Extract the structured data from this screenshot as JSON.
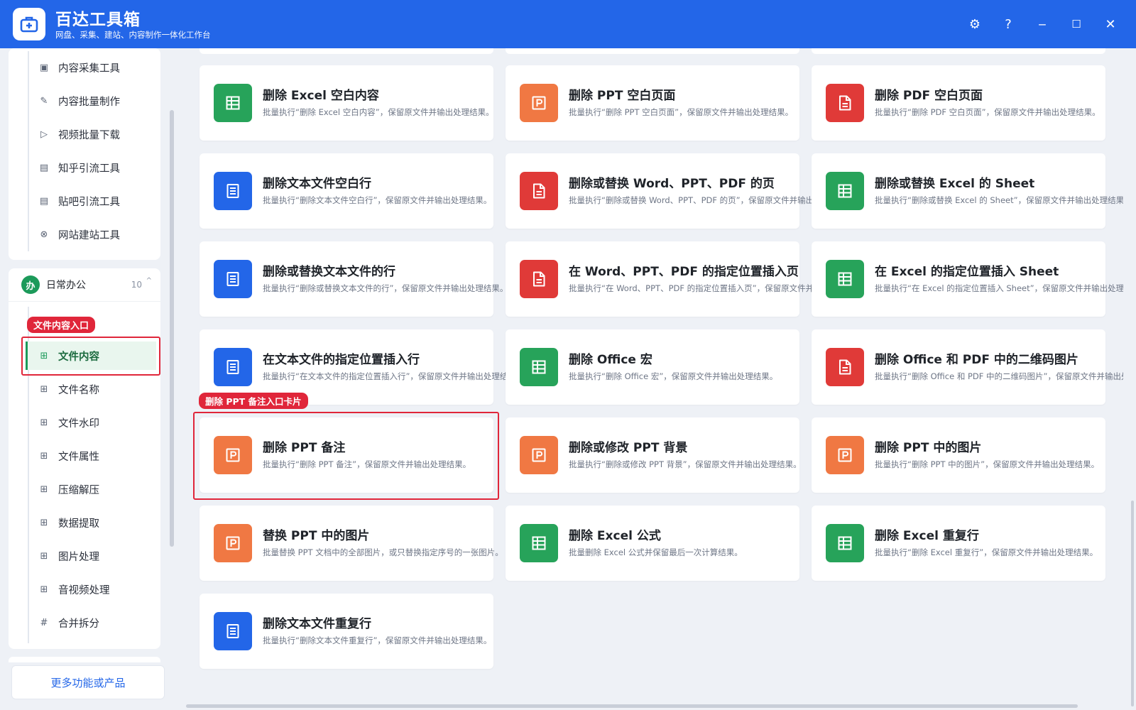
{
  "app": {
    "title": "百达工具箱",
    "subtitle": "网盘、采集、建站、内容制作一体化工作台",
    "controls": {
      "settings": "⚙",
      "help": "?",
      "minimize": "‒",
      "maximize": "☐",
      "close": "✕"
    }
  },
  "sidebar": {
    "upper_items": [
      {
        "label": "内容采集工具",
        "icon": "▣"
      },
      {
        "label": "内容批量制作",
        "icon": "✎"
      },
      {
        "label": "视频批量下载",
        "icon": "▷"
      },
      {
        "label": "知乎引流工具",
        "icon": "▤"
      },
      {
        "label": "贴吧引流工具",
        "icon": "▤"
      },
      {
        "label": "网站建站工具",
        "icon": "⊗"
      }
    ],
    "group": {
      "icon": "办",
      "label": "日常办公",
      "count": "10",
      "caret": "^"
    },
    "group_items": [
      {
        "label": "文件内容",
        "icon": "⊞"
      },
      {
        "label": "文件名称",
        "icon": "⊞"
      },
      {
        "label": "文件水印",
        "icon": "⊞"
      },
      {
        "label": "文件属性",
        "icon": "⊞"
      },
      {
        "label": "压缩解压",
        "icon": "⊞"
      },
      {
        "label": "数据提取",
        "icon": "⊞"
      },
      {
        "label": "图片处理",
        "icon": "⊞"
      },
      {
        "label": "音视频处理",
        "icon": "⊞"
      },
      {
        "label": "合并拆分",
        "icon": "#"
      }
    ],
    "more_button": "更多功能或产品"
  },
  "annotations": {
    "sidebar_tag": "文件内容入口",
    "card_tag": "删除 PPT 备注入口卡片"
  },
  "colors": {
    "green": "#27a35a",
    "orange": "#f07843",
    "red": "#e03a38",
    "blue": "#2366e8"
  },
  "cards": [
    {
      "title": "删除 Excel 空白内容",
      "desc": "批量执行“删除 Excel 空白内容”，保留原文件并输出处理结果。",
      "icon": "excel-sheet-icon",
      "color": "green"
    },
    {
      "title": "删除 PPT 空白页面",
      "desc": "批量执行“删除 PPT 空白页面”，保留原文件并输出处理结果。",
      "icon": "ppt-icon",
      "color": "orange"
    },
    {
      "title": "删除 PDF 空白页面",
      "desc": "批量执行“删除 PDF 空白页面”，保留原文件并输出处理结果。",
      "icon": "pdf-doc-icon",
      "color": "red"
    },
    {
      "title": "删除文本文件空白行",
      "desc": "批量执行“删除文本文件空白行”，保留原文件并输出处理结果。",
      "icon": "text-doc-icon",
      "color": "blue"
    },
    {
      "title": "删除或替换 Word、PPT、PDF 的页",
      "desc": "批量执行“删除或替换 Word、PPT、PDF 的页”，保留原文件并输出处理结果。",
      "icon": "pdf-doc-icon",
      "color": "red"
    },
    {
      "title": "删除或替换 Excel 的 Sheet",
      "desc": "批量执行“删除或替换 Excel 的 Sheet”，保留原文件并输出处理结果。",
      "icon": "excel-sheet-icon",
      "color": "green"
    },
    {
      "title": "删除或替换文本文件的行",
      "desc": "批量执行“删除或替换文本文件的行”，保留原文件并输出处理结果。",
      "icon": "text-doc-icon",
      "color": "blue"
    },
    {
      "title": "在 Word、PPT、PDF 的指定位置插入页",
      "desc": "批量执行“在 Word、PPT、PDF 的指定位置插入页”，保留原文件并输出处理结果。",
      "icon": "pdf-doc-icon",
      "color": "red"
    },
    {
      "title": "在 Excel 的指定位置插入 Sheet",
      "desc": "批量执行“在 Excel 的指定位置插入 Sheet”，保留原文件并输出处理结果。",
      "icon": "excel-sheet-icon",
      "color": "green"
    },
    {
      "title": "在文本文件的指定位置插入行",
      "desc": "批量执行“在文本文件的指定位置插入行”，保留原文件并输出处理结果。",
      "icon": "text-doc-icon",
      "color": "blue"
    },
    {
      "title": "删除 Office 宏",
      "desc": "批量执行“删除 Office 宏”，保留原文件并输出处理结果。",
      "icon": "excel-sheet-icon",
      "color": "green"
    },
    {
      "title": "删除 Office 和 PDF 中的二维码图片",
      "desc": "批量执行“删除 Office 和 PDF 中的二维码图片”，保留原文件并输出处理结果。",
      "icon": "pdf-doc-icon",
      "color": "red"
    },
    {
      "title": "删除 PPT 备注",
      "desc": "批量执行“删除 PPT 备注”，保留原文件并输出处理结果。",
      "icon": "ppt-icon",
      "color": "orange"
    },
    {
      "title": "删除或修改 PPT 背景",
      "desc": "批量执行“删除或修改 PPT 背景”，保留原文件并输出处理结果。",
      "icon": "ppt-icon",
      "color": "orange"
    },
    {
      "title": "删除 PPT 中的图片",
      "desc": "批量执行“删除 PPT 中的图片”，保留原文件并输出处理结果。",
      "icon": "ppt-icon",
      "color": "orange"
    },
    {
      "title": "替换 PPT 中的图片",
      "desc": "批量替换 PPT 文档中的全部图片，或只替换指定序号的一张图片。",
      "icon": "ppt-icon",
      "color": "orange"
    },
    {
      "title": "删除 Excel 公式",
      "desc": "批量删除 Excel 公式并保留最后一次计算结果。",
      "icon": "excel-sheet-icon",
      "color": "green"
    },
    {
      "title": "删除 Excel 重复行",
      "desc": "批量执行“删除 Excel 重复行”，保留原文件并输出处理结果。",
      "icon": "excel-sheet-icon",
      "color": "green"
    },
    {
      "title": "删除文本文件重复行",
      "desc": "批量执行“删除文本文件重复行”，保留原文件并输出处理结果。",
      "icon": "text-doc-icon",
      "color": "blue"
    }
  ]
}
